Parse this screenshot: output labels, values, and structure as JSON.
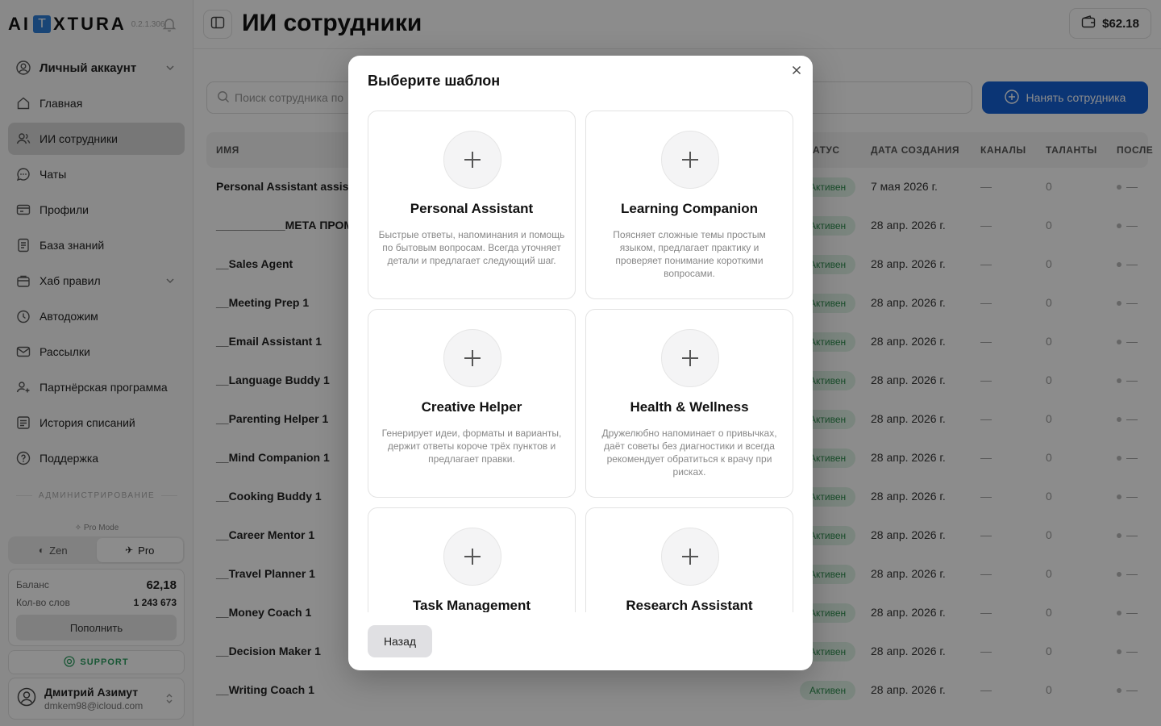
{
  "app": {
    "logo_left": "AI",
    "logo_box": "T",
    "logo_right": "XTURA",
    "version": "0.2.1.306"
  },
  "sidebar": {
    "account": "Личный аккаунт",
    "items": [
      {
        "label": "Главная",
        "icon": "home-icon"
      },
      {
        "label": "ИИ сотрудники",
        "icon": "users-icon",
        "active": true
      },
      {
        "label": "Чаты",
        "icon": "chat-icon"
      },
      {
        "label": "Профили",
        "icon": "id-card-icon"
      },
      {
        "label": "База знаний",
        "icon": "document-icon"
      },
      {
        "label": "Хаб правил",
        "icon": "bag-icon"
      },
      {
        "label": "Автодожим",
        "icon": "clock-icon"
      },
      {
        "label": "Рассылки",
        "icon": "mail-icon"
      },
      {
        "label": "Партнёрская программа",
        "icon": "partners-icon"
      },
      {
        "label": "История списаний",
        "icon": "list-icon"
      },
      {
        "label": "Поддержка",
        "icon": "help-icon"
      }
    ],
    "admin_label": "АДМИНИСТРИРОВАНИЕ",
    "pro_mode_label": "Pro Mode",
    "mode_zen": "Zen",
    "mode_pro": "Pro",
    "balance_label": "Баланс",
    "balance_value": "62,18",
    "words_label": "Кол-во слов",
    "words_value": "1 243 673",
    "topup_label": "Пополнить",
    "support_label": "SUPPORT",
    "user_name": "Дмитрий Азимут",
    "user_email": "dmkem98@icloud.com"
  },
  "header": {
    "title": "ИИ сотрудники",
    "balance": "$62.18"
  },
  "toolbar": {
    "search_placeholder": "Поиск сотрудника по",
    "hire_label": "Нанять сотрудника"
  },
  "table": {
    "columns": {
      "name": "ИМЯ",
      "status": "АТУС",
      "created": "ДАТА СОЗДАНИЯ",
      "channels": "КАНАЛЫ",
      "talents": "ТАЛАНТЫ",
      "last": "ПОСЛЕ"
    },
    "rows": [
      {
        "name": "Personal Assistant assis",
        "status": "Активен",
        "date": "7 мая 2026 г.",
        "channels": "—",
        "talents": "0",
        "last": "—"
      },
      {
        "name": "___________МЕТА ПРОМ",
        "status": "Активен",
        "date": "28 апр. 2026 г.",
        "channels": "—",
        "talents": "0",
        "last": "—"
      },
      {
        "name": "__Sales Agent",
        "status": "Активен",
        "date": "28 апр. 2026 г.",
        "channels": "—",
        "talents": "0",
        "last": "—"
      },
      {
        "name": "__Meeting Prep 1",
        "status": "Активен",
        "date": "28 апр. 2026 г.",
        "channels": "—",
        "talents": "0",
        "last": "—"
      },
      {
        "name": "__Email Assistant 1",
        "status": "Активен",
        "date": "28 апр. 2026 г.",
        "channels": "—",
        "talents": "0",
        "last": "—"
      },
      {
        "name": "__Language Buddy 1",
        "status": "Активен",
        "date": "28 апр. 2026 г.",
        "channels": "—",
        "talents": "0",
        "last": "—"
      },
      {
        "name": "__Parenting Helper 1",
        "status": "Активен",
        "date": "28 апр. 2026 г.",
        "channels": "—",
        "talents": "0",
        "last": "—"
      },
      {
        "name": "__Mind Companion 1",
        "status": "Активен",
        "date": "28 апр. 2026 г.",
        "channels": "—",
        "talents": "0",
        "last": "—"
      },
      {
        "name": "__Cooking Buddy 1",
        "status": "Активен",
        "date": "28 апр. 2026 г.",
        "channels": "—",
        "talents": "0",
        "last": "—"
      },
      {
        "name": "__Career Mentor 1",
        "status": "Активен",
        "date": "28 апр. 2026 г.",
        "channels": "—",
        "talents": "0",
        "last": "—"
      },
      {
        "name": "__Travel Planner 1",
        "status": "Активен",
        "date": "28 апр. 2026 г.",
        "channels": "—",
        "talents": "0",
        "last": "—"
      },
      {
        "name": "__Money Coach 1",
        "status": "Активен",
        "date": "28 апр. 2026 г.",
        "channels": "—",
        "talents": "0",
        "last": "—"
      },
      {
        "name": "__Decision Maker 1",
        "status": "Активен",
        "date": "28 апр. 2026 г.",
        "channels": "—",
        "talents": "0",
        "last": "—"
      },
      {
        "name": "__Writing Coach 1",
        "status": "Активен",
        "date": "28 апр. 2026 г.",
        "channels": "—",
        "talents": "0",
        "last": "—"
      }
    ]
  },
  "modal": {
    "title": "Выберите шаблон",
    "back_label": "Назад",
    "templates": [
      {
        "name": "Personal Assistant",
        "desc": "Быстрые ответы, напоминания и помощь по бытовым вопросам. Всегда уточняет детали и предлагает следующий шаг."
      },
      {
        "name": "Learning Companion",
        "desc": "Поясняет сложные темы простым языком, предлагает практику и проверяет понимание короткими вопросами."
      },
      {
        "name": "Creative Helper",
        "desc": "Генерирует идеи, форматы и варианты, держит ответы короче трёх пунктов и предлагает правки."
      },
      {
        "name": "Health & Wellness",
        "desc": "Дружелюбно напоминает о привычках, даёт советы без диагностики и всегда рекомендует обратиться к врачу при рисках."
      },
      {
        "name": "Task Management",
        "desc": ""
      },
      {
        "name": "Research Assistant",
        "desc": ""
      }
    ]
  },
  "colors": {
    "accent": "#1561d6",
    "status_bg": "#dff3e5",
    "status_text": "#2d8a4d",
    "support": "#2e9e62"
  }
}
